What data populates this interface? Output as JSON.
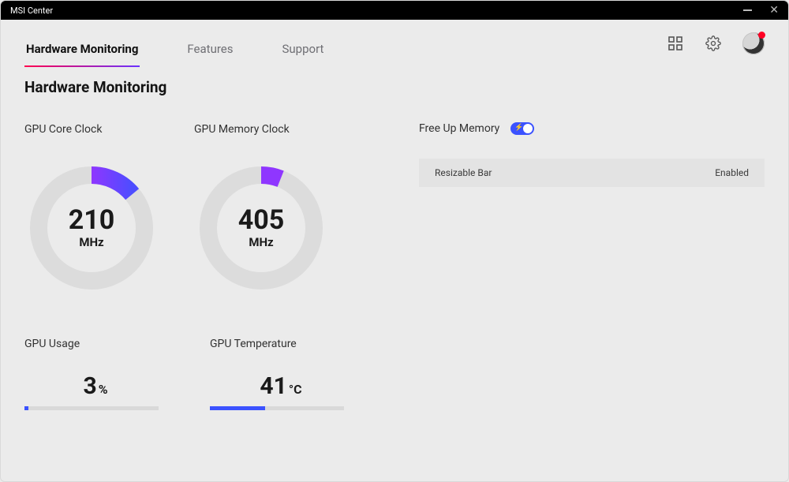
{
  "window_title": "MSI Center",
  "tabs": {
    "t0": "Hardware Monitoring",
    "t1": "Features",
    "t2": "Support"
  },
  "active_tab_index": 0,
  "page_title": "Hardware Monitoring",
  "gauge1": {
    "label": "GPU Core Clock",
    "value": "210",
    "unit": "MHz",
    "fraction": 0.14,
    "color_a": "#8f36ff",
    "color_b": "#4d4dff"
  },
  "gauge2": {
    "label": "GPU Memory Clock",
    "value": "405",
    "unit": "MHz",
    "fraction": 0.06,
    "color_a": "#8f36ff",
    "color_b": "#8f36ff"
  },
  "bar1": {
    "label": "GPU Usage",
    "value": "3",
    "unit": "%",
    "fraction": 0.03
  },
  "bar2": {
    "label": "GPU Temperature",
    "value": "41",
    "unit": "°C",
    "fraction": 0.41
  },
  "freeup_label": "Free Up Memory",
  "freeup_on": true,
  "setting_row": {
    "name": "Resizable Bar",
    "status": "Enabled"
  },
  "track_color": "#dcdcdc",
  "accent_color": "#3b52ff"
}
